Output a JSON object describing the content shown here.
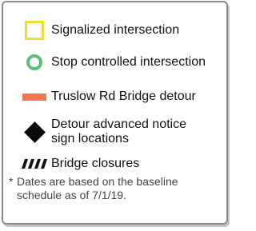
{
  "legend": {
    "items": [
      {
        "icon": "yellow-square-icon",
        "color": "#f2de33",
        "label": "Signalized intersection"
      },
      {
        "icon": "green-circle-icon",
        "color": "#5bbf7a",
        "label": "Stop controlled intersection"
      },
      {
        "icon": "orange-bar-icon",
        "color": "#f2794f",
        "label": "Truslow Rd Bridge detour"
      },
      {
        "icon": "black-diamond-icon",
        "color": "#0a0a0a",
        "label": "Detour advanced notice\nsign locations"
      },
      {
        "icon": "hatched-closure-icon",
        "color": "#111111",
        "label": "Bridge closures"
      }
    ],
    "footnote_mark": "*",
    "footnote": "Dates are based on the baseline schedule as of 7/1/19."
  }
}
